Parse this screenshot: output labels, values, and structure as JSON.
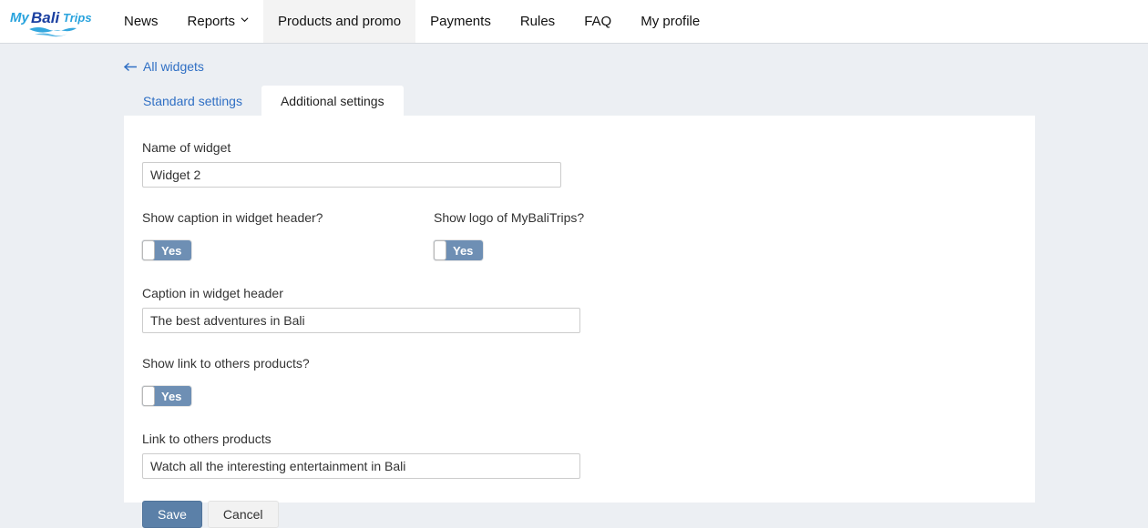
{
  "header": {
    "logo": {
      "name": "mybalitrips-logo",
      "part_my": "My",
      "part_bali": "Bali",
      "part_trips": "Trips",
      "color_my": "#29a3dd",
      "color_bali": "#1a3fa0",
      "color_trips": "#29a3dd",
      "wave_color": "#29a3dd"
    },
    "nav": [
      {
        "label": "News",
        "active": false,
        "has_caret": false
      },
      {
        "label": "Reports",
        "active": false,
        "has_caret": true
      },
      {
        "label": "Products and promo",
        "active": true,
        "has_caret": false
      },
      {
        "label": "Payments",
        "active": false,
        "has_caret": false
      },
      {
        "label": "Rules",
        "active": false,
        "has_caret": false
      },
      {
        "label": "FAQ",
        "active": false,
        "has_caret": false
      },
      {
        "label": "My profile",
        "active": false,
        "has_caret": false
      }
    ]
  },
  "back_link": {
    "label": "All widgets",
    "icon": "arrow-left-icon"
  },
  "tabs": [
    {
      "label": "Standard settings",
      "active": false
    },
    {
      "label": "Additional settings",
      "active": true
    }
  ],
  "form": {
    "name_of_widget": {
      "label": "Name of widget",
      "value": "Widget 2",
      "placeholder": ""
    },
    "show_caption": {
      "label": "Show caption in widget header?",
      "toggle_text": "Yes",
      "state": "on"
    },
    "show_logo": {
      "label": "Show logo of MyBaliTrips?",
      "toggle_text": "Yes",
      "state": "on"
    },
    "caption_in_header": {
      "label": "Caption in widget header",
      "value": "The best adventures in Bali",
      "placeholder": ""
    },
    "show_link": {
      "label": "Show link to others products?",
      "toggle_text": "Yes",
      "state": "on"
    },
    "link_to_products": {
      "label": "Link to others products",
      "value": "Watch all the interesting entertainment in Bali",
      "placeholder": ""
    },
    "save_label": "Save",
    "cancel_label": "Cancel"
  },
  "colors": {
    "page_background": "#eceff3",
    "card_background": "#ffffff",
    "link": "#2f6fc4",
    "toggle_on": "#6e8fb4",
    "primary_button": "#5b80a8",
    "default_button": "#f2f2f2",
    "nav_active_background": "#f3f3f3"
  }
}
